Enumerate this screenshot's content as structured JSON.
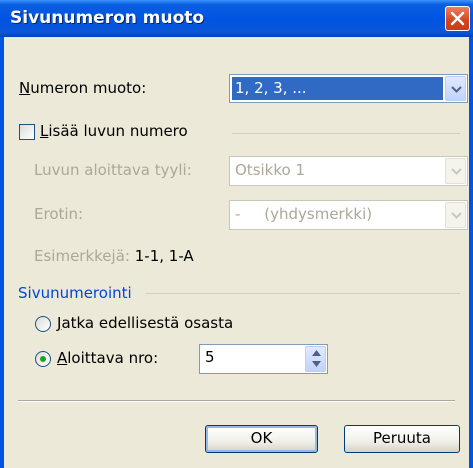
{
  "window": {
    "title": "Sivunumeron muoto"
  },
  "number_format": {
    "label_first": "N",
    "label_rest": "umeron muoto:",
    "value": "1, 2, 3, ..."
  },
  "chapter": {
    "checkbox_first": "L",
    "checkbox_rest": "isää luvun numero",
    "checked": false,
    "style_label": "Luvun aloittava tyyli:",
    "style_value": "Otsikko 1",
    "separator_label": "Erotin:",
    "separator_value": "-     (yhdysmerkki)",
    "examples_label": "Esimerkkejä:",
    "examples_value": "1-1, 1-A"
  },
  "page_numbering": {
    "group_title": "Sivunumerointi",
    "continue_first": "J",
    "continue_rest": "atka edellisestä osasta",
    "start_first": "A",
    "start_rest": "loittava nro:",
    "selected": "start",
    "start_value": "5"
  },
  "buttons": {
    "ok": "OK",
    "cancel": "Peruuta"
  },
  "colors": {
    "titlebar": "#0054e3",
    "selection": "#316ac5",
    "group_title": "#0046d5",
    "close": "#d8421e"
  }
}
